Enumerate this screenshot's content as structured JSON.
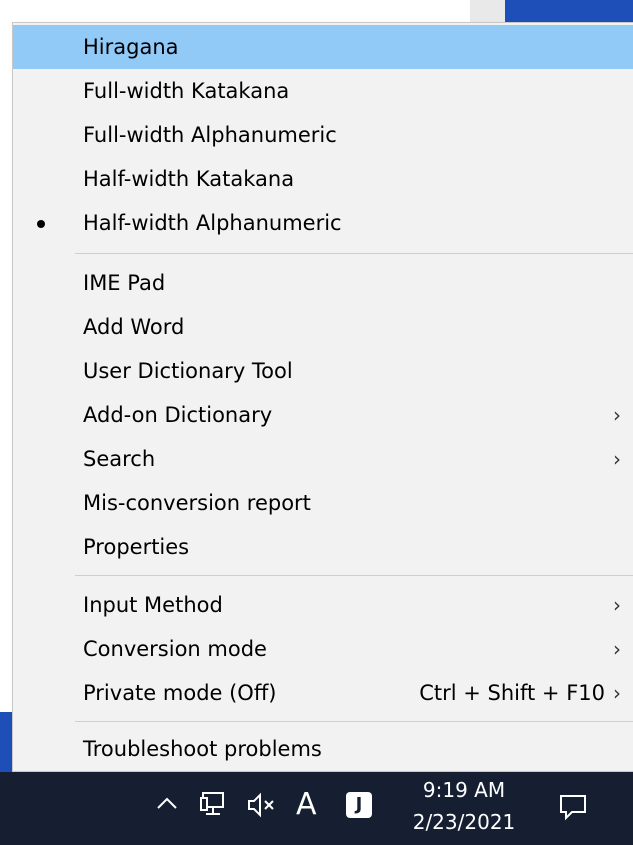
{
  "menu": {
    "items": [
      {
        "label": "Hiragana",
        "highlighted": true
      },
      {
        "label": "Full-width Katakana"
      },
      {
        "label": "Full-width Alphanumeric"
      },
      {
        "label": "Half-width Katakana"
      },
      {
        "label": "Half-width Alphanumeric",
        "selected": true
      },
      {
        "label": "IME Pad"
      },
      {
        "label": "Add Word"
      },
      {
        "label": "User Dictionary Tool"
      },
      {
        "label": "Add-on Dictionary",
        "submenu": true
      },
      {
        "label": "Search",
        "submenu": true
      },
      {
        "label": "Mis-conversion report"
      },
      {
        "label": "Properties"
      },
      {
        "label": "Input Method",
        "submenu": true
      },
      {
        "label": "Conversion mode",
        "submenu": true
      },
      {
        "label": "Private mode (Off)",
        "shortcut": "Ctrl + Shift + F10",
        "submenu": true
      },
      {
        "label": "Troubleshoot problems"
      }
    ],
    "submenu_glyph": "›",
    "highlight_color": "#91c9f7"
  },
  "taskbar": {
    "ime_mode_glyph": "A",
    "ime_app_glyph": "J",
    "time": "9:19 AM",
    "date": "2/23/2021",
    "background_color": "#151f31"
  }
}
